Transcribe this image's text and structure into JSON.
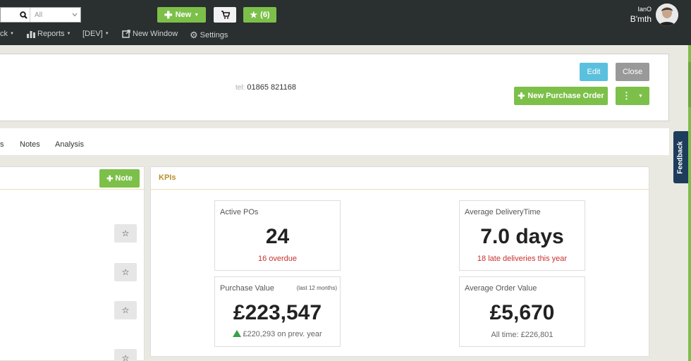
{
  "search": {
    "placeholder": "",
    "scope": "All"
  },
  "topbar": {
    "new_label": "New",
    "starred_label": "(6)",
    "user_name": "IanO",
    "user_location": "B'mth"
  },
  "nav": [
    {
      "label": "ck"
    },
    {
      "label": "Reports"
    },
    {
      "label": "[DEV]"
    },
    {
      "label": "New Window"
    },
    {
      "label": "Settings"
    }
  ],
  "header": {
    "tel_label": "tel:",
    "tel_value": "01865 821168",
    "edit_label": "Edit",
    "close_label": "Close",
    "new_po_label": "New Purchase Order"
  },
  "tabs": [
    {
      "label": "s"
    },
    {
      "label": "Notes"
    },
    {
      "label": "Analysis"
    }
  ],
  "notes": {
    "note_label": "Note"
  },
  "kpis": {
    "title": "KPIs",
    "cards": [
      {
        "title": "Active POs",
        "sub": "",
        "value": "24",
        "foot": "16 overdue"
      },
      {
        "title": "Average DeliveryTime",
        "sub": "",
        "value": "7.0 days",
        "foot": "18 late deliveries this year"
      },
      {
        "title": "Purchase Value",
        "sub": "(last 12 months)",
        "value": "£223,547",
        "foot": "£220,293 on prev. year"
      },
      {
        "title": "Average Order Value",
        "sub": "",
        "value": "£5,670",
        "foot": "All time: £226,801"
      }
    ]
  },
  "feedback": {
    "label": "Feedback"
  },
  "colors": {
    "green": "#7cc04a",
    "edit_blue": "#5bc0de",
    "topbar": "#2a2f2f",
    "kpi_title": "#b8902a",
    "alert_red": "#c9302c",
    "trend_up": "#3aa047"
  }
}
